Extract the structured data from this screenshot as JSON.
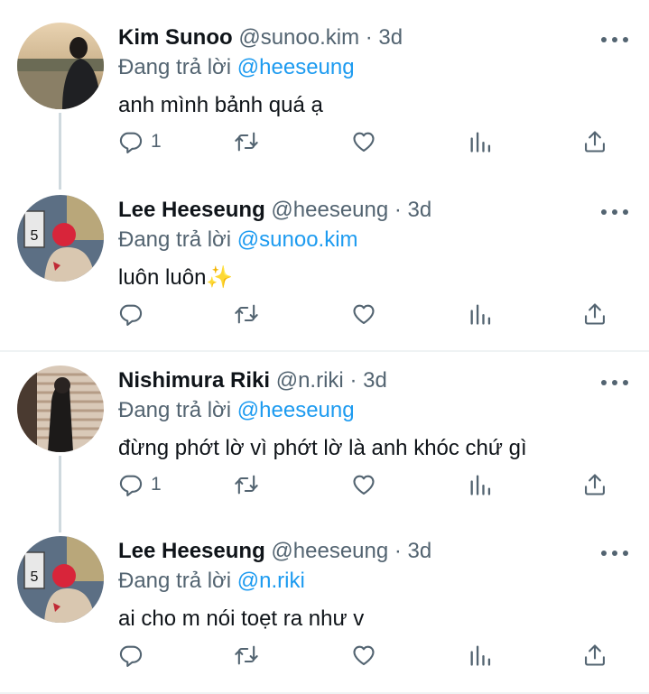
{
  "tweets": [
    {
      "name": "Kim Sunoo",
      "handle": "@sunoo.kim",
      "dot": "·",
      "time": "3d",
      "reply_prefix": "Đang trả lời",
      "reply_to": "@heeseung",
      "text": "anh mình bảnh quá ạ",
      "text_emoji": "",
      "reply_count": "1",
      "avatar_icon": "avatar-sunoo"
    },
    {
      "name": "Lee Heeseung",
      "handle": "@heeseung",
      "dot": "·",
      "time": "3d",
      "reply_prefix": "Đang trả lời",
      "reply_to": "@sunoo.kim",
      "text": "luôn luôn",
      "text_emoji": "✨",
      "reply_count": "",
      "avatar_icon": "avatar-heeseung"
    },
    {
      "name": "Nishimura Riki",
      "handle": "@n.riki",
      "dot": "·",
      "time": "3d",
      "reply_prefix": "Đang trả lời",
      "reply_to": "@heeseung",
      "text": "đừng phớt lờ vì phớt lờ là anh khóc chứ gì",
      "text_emoji": "",
      "reply_count": "1",
      "avatar_icon": "avatar-riki"
    },
    {
      "name": "Lee Heeseung",
      "handle": "@heeseung",
      "dot": "·",
      "time": "3d",
      "reply_prefix": "Đang trả lời",
      "reply_to": "@n.riki",
      "text": "ai cho m nói toẹt ra như v",
      "text_emoji": "",
      "reply_count": "",
      "avatar_icon": "avatar-heeseung"
    }
  ],
  "icons": {
    "more": "more-icon",
    "reply": "reply-icon",
    "retweet": "retweet-icon",
    "like": "heart-icon",
    "analytics": "analytics-icon",
    "share": "share-icon"
  },
  "colors": {
    "mention": "#1d9bf0",
    "muted": "#536471",
    "text": "#0f1419",
    "thread_line": "#cfd9de"
  }
}
